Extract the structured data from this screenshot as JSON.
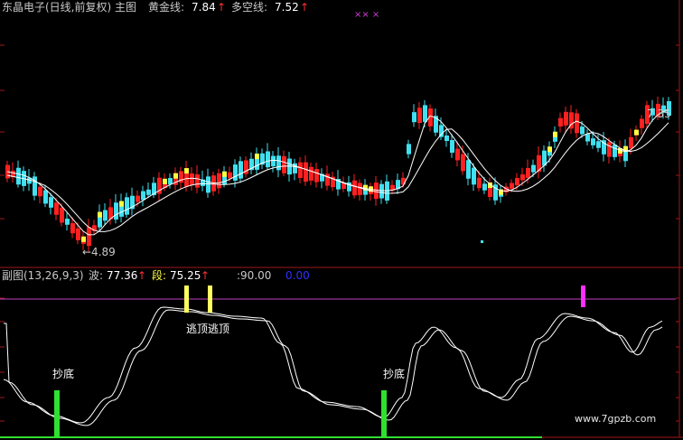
{
  "main_header": {
    "title": "东晶电子(日线,前复权) 主图",
    "gold_label": "黄金线:",
    "gold_value": "7.84",
    "longshort_label": "多空线:",
    "longshort_value": "7.52",
    "arrow": "↑"
  },
  "main_chart": {
    "price_right_label": "7.35",
    "low_label": "←4.89",
    "top_marks": "×× ×"
  },
  "sub_header": {
    "title": "副图(13,26,9,3)",
    "wave_label": "波:",
    "wave_value": "77.36",
    "segment_label": "段:",
    "segment_value": "75.25",
    "arrow": "↑",
    "level_value": ":90.00",
    "zero_value": "0.00"
  },
  "sub_chart": {
    "signals": [
      {
        "text": "抄底",
        "type": "buy"
      },
      {
        "text": "逃顶逃顶",
        "type": "sell"
      },
      {
        "text": "抄底",
        "type": "buy"
      }
    ]
  },
  "watermark": "www.7gpzb.com",
  "colors": {
    "up": "#ff2020",
    "down": "#40e0f0",
    "gold": "#ffff40",
    "ma": "#ffffff",
    "sell_bar": "#ffff60",
    "buy_bar": "#30e030",
    "magenta": "#ff30ff",
    "level_line": "#c040c0",
    "divider": "#a01818"
  }
}
